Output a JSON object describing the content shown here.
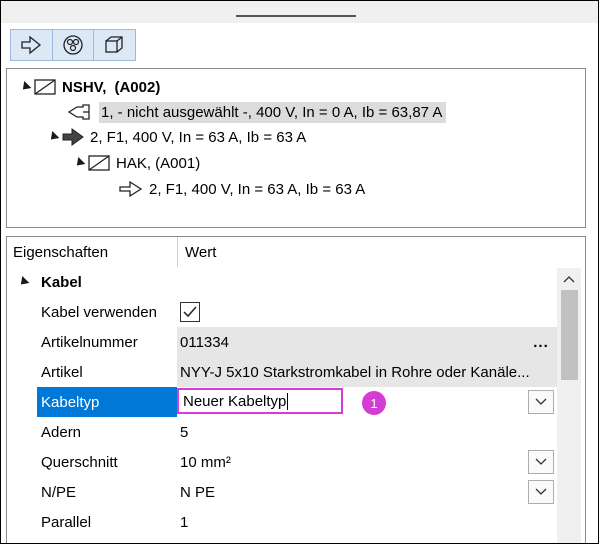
{
  "tree": {
    "root": {
      "name": "NSHV,",
      "code": "(A002)"
    },
    "items": [
      {
        "text": "1,  - nicht ausgewählt -, 400 V, In = 0 A, Ib = 63,87 A"
      },
      {
        "text": "2, F1, 400 V, In = 63 A, Ib = 63 A"
      },
      {
        "text": "HAK,  (A001)"
      },
      {
        "text": "2, F1, 400 V, In = 63 A, Ib = 63 A"
      }
    ]
  },
  "properties": {
    "header": {
      "col1": "Eigenschaften",
      "col2": "Wert"
    },
    "section": "Kabel",
    "rows": [
      {
        "label": "Kabel verwenden",
        "value": ""
      },
      {
        "label": "Artikelnummer",
        "value": "011334"
      },
      {
        "label": "Artikel",
        "value": "NYY-J 5x10 Starkstromkabel in Rohre oder Kanäle..."
      },
      {
        "label": "Kabeltyp",
        "value": "Neuer Kabeltyp"
      },
      {
        "label": "Adern",
        "value": "5"
      },
      {
        "label": "Querschnitt",
        "value": "10 mm²"
      },
      {
        "label": "N/PE",
        "value": "N PE"
      },
      {
        "label": "Parallel",
        "value": "1"
      }
    ],
    "checkbox_checked": true,
    "ellipsis": "...",
    "badge": "1"
  },
  "colors": {
    "selection": "#0078d7",
    "highlight": "#d83bd8"
  },
  "icons": [
    "send-arrow-icon",
    "network-icon",
    "cube-icon",
    "expand-triangle-icon",
    "distribution-box-icon",
    "feeder-outline-icon",
    "feeder-filled-icon",
    "dropdown-chevron-icon",
    "scroll-up-icon",
    "checkmark-icon"
  ]
}
